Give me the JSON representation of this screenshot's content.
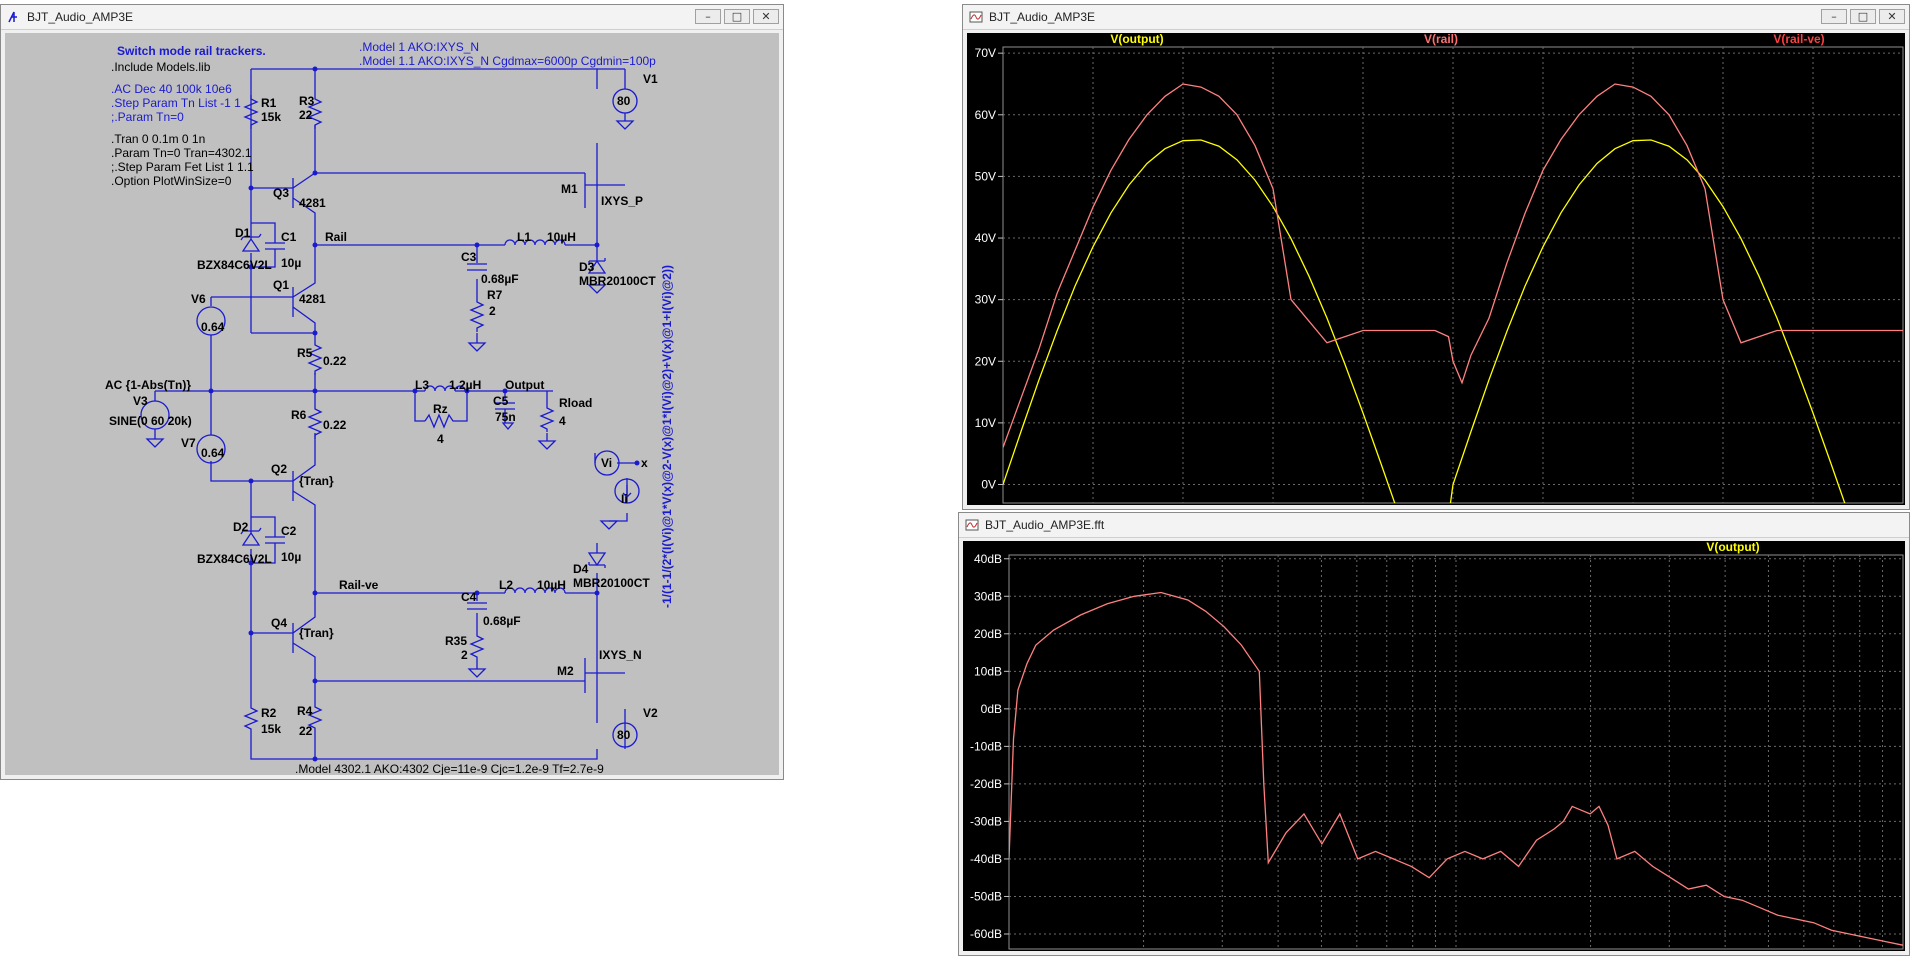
{
  "schematic_window": {
    "title": "BJT_Audio_AMP3E",
    "icon": "schematic-icon"
  },
  "plot_window": {
    "title": "BJT_Audio_AMP3E",
    "icon": "waveform-icon"
  },
  "fft_window": {
    "title": "BJT_Audio_AMP3E.fft",
    "icon": "waveform-icon"
  },
  "window_buttons": {
    "minimize": "–",
    "maximize": "□",
    "close": "✕"
  },
  "colors": {
    "wire": "#1a1ad0",
    "schem_bg": "#c0c0c0",
    "plot_bg": "#000000",
    "trace_output": "#ffff00",
    "trace_rail": "#ff8080",
    "label_output": "#ffff00",
    "label_rail": "#ff7070",
    "label_railve": "#ff4040",
    "grid": "#707070"
  },
  "directives": [
    "Switch mode rail trackers.",
    ".Include Models.lib",
    ".AC Dec 40 100k 10e6",
    ".Step Param Tn List -1 1",
    ";.Param Tn=0",
    ".Tran 0 0.1m 0 1n",
    ".Param Tn=0 Tran=4302.1",
    ";.Step Param Fet List 1 1.1",
    ".Option PlotWinSize=0"
  ],
  "model_directives": [
    ".Model 1 AKO:IXYS_N",
    ".Model 1.1 AKO:IXYS_N Cgdmax=6000p Cgdmin=100p"
  ],
  "bottom_model": ".Model 4302.1 AKO:4302 Cje=11e-9 Cjc=1.2e-9 Tf=2.7e-9",
  "vertical_expr": "-1/(1-1/(2*(I(Vi)@1*V(x)@2-V(x)@1*I(Vi)@2)+V(x)@1+I(Vi)@2))",
  "components": {
    "R1": "R1",
    "R1v": "15k",
    "R3": "R3",
    "R3v": "22",
    "V1": "V1",
    "V1v": "80",
    "Q3": "Q3",
    "Q3v": "4281",
    "M1": "M1",
    "M1v": "IXYS_P",
    "D1": "D1",
    "D1v": "BZX84C6V2L",
    "C1": "C1",
    "C1v": "10µ",
    "Rail": "Rail",
    "C3": "C3",
    "C3v": "0.68µF",
    "L1": "L1",
    "L1v": "10µH",
    "D3": "D3",
    "D3v": "MBR20100CT",
    "R7": "R7",
    "R7v": "2",
    "Q1": "Q1",
    "Q1v": "4281",
    "V6": "V6",
    "V6v": "0.64",
    "R5": "R5",
    "R5v": "0.22",
    "AC": "AC {1-Abs(Tn)}",
    "V3": "V3",
    "V3v": "SINE(0 60 20k)",
    "L3": "L3",
    "L3v": "1.2µH",
    "Output": "Output",
    "Rz": "Rz",
    "Rzv": "4",
    "C5": "C5",
    "C5v": "75n",
    "Rload": "Rload",
    "Rloadv": "4",
    "R6": "R6",
    "R6v": "0.22",
    "V7": "V7",
    "V7v": "0.64",
    "Vi": "Vi",
    "Ii": "Ii",
    "X": "x",
    "Q2": "Q2",
    "Q2v": "{Tran}",
    "D2": "D2",
    "D2v": "BZX84C6V2L",
    "C2": "C2",
    "C2v": "10µ",
    "D4": "D4",
    "D4v": "MBR20100CT",
    "Railve": "Rail-ve",
    "C4": "C4",
    "C4v": "0.68µF",
    "L2": "L2",
    "L2v": "10µH",
    "R35": "R35",
    "R35v": "2",
    "Q4": "Q4",
    "Q4v": "{Tran}",
    "M2": "M2",
    "M2v": "IXYS_N",
    "R2": "R2",
    "R2v": "15k",
    "R4": "R4",
    "R4v": "22",
    "V2": "V2",
    "V2v": "80"
  },
  "chart_data": [
    {
      "type": "line",
      "title": "",
      "legend": [
        "V(output)",
        "V(rail)",
        "V(rail-ve)"
      ],
      "y_tick_labels": [
        "0V",
        "10V",
        "20V",
        "30V",
        "40V",
        "50V",
        "60V",
        "70V"
      ],
      "ylim": [
        -3,
        71
      ],
      "xlim": [
        0,
        100
      ],
      "grid": true,
      "series": [
        {
          "name": "V(output)",
          "color": "#ffff00",
          "x": [
            0,
            2,
            4,
            6,
            8,
            10,
            12,
            14,
            16,
            18,
            20,
            22,
            24,
            26,
            28,
            30,
            32,
            34,
            36,
            38,
            40,
            42,
            44,
            46,
            48,
            50,
            52,
            54,
            56,
            58,
            60,
            62,
            64,
            66,
            68,
            70,
            72,
            74,
            76,
            78,
            80,
            82,
            84,
            86,
            88,
            90,
            92,
            94,
            96,
            98,
            100
          ],
          "y": [
            0,
            8.6,
            17,
            24.9,
            32.2,
            38.6,
            44.1,
            48.6,
            52.1,
            54.5,
            55.8,
            55.9,
            54.9,
            52.7,
            49.4,
            45.1,
            39.9,
            33.8,
            27,
            19.5,
            11.6,
            3.4,
            -5,
            -13.3,
            -21.3,
            0,
            8.6,
            17,
            24.9,
            32.2,
            38.6,
            44.1,
            48.6,
            52.1,
            54.5,
            55.8,
            55.9,
            54.9,
            52.7,
            49.4,
            45.1,
            39.9,
            33.8,
            27,
            19.5,
            11.6,
            3.4,
            -5,
            -13.3,
            -21.3,
            -28.8
          ]
        },
        {
          "name": "V(rail)",
          "color": "#ff8080",
          "x": [
            0,
            2,
            4,
            6,
            8,
            10,
            12,
            14,
            16,
            18,
            20,
            22,
            24,
            26,
            28,
            30,
            32,
            36,
            40,
            44,
            48,
            49.5,
            50,
            51,
            52,
            54,
            56,
            58,
            60,
            62,
            64,
            66,
            68,
            70,
            72,
            74,
            76,
            78,
            80,
            82,
            86,
            90,
            94,
            98,
            100
          ],
          "y": [
            6,
            14,
            22,
            31,
            38,
            45,
            51,
            56,
            60,
            63,
            65,
            64.5,
            63,
            60,
            55,
            48,
            30,
            23,
            25,
            25,
            25,
            24,
            20,
            16.5,
            21,
            27,
            36,
            44,
            51,
            56,
            60,
            63,
            65,
            64.5,
            63,
            60,
            55,
            48,
            30,
            23,
            25,
            25,
            25,
            25,
            25
          ]
        }
      ]
    },
    {
      "type": "line",
      "title": "",
      "legend": [
        "V(output)"
      ],
      "y_tick_labels": [
        "-60dB",
        "-50dB",
        "-40dB",
        "-30dB",
        "-20dB",
        "-10dB",
        "0dB",
        "10dB",
        "20dB",
        "30dB",
        "40dB"
      ],
      "ylim": [
        -64,
        41
      ],
      "xlim": [
        0,
        100
      ],
      "grid": true,
      "series": [
        {
          "name": "V(output)",
          "color": "#ff8080",
          "x": [
            0,
            0.5,
            1,
            2,
            3,
            5,
            8,
            11,
            14,
            17,
            20,
            22,
            24,
            26,
            28,
            28.5,
            29,
            31,
            33,
            35,
            37,
            39,
            41,
            43,
            45,
            47,
            49,
            51,
            53,
            55,
            57,
            59,
            61,
            62,
            63,
            64,
            65,
            66,
            67,
            68,
            70,
            72,
            74,
            76,
            78,
            80,
            82,
            84,
            86,
            88,
            90,
            92,
            94,
            96,
            98,
            100
          ],
          "y": [
            -40,
            -8,
            5,
            12,
            17,
            21,
            25,
            28,
            30,
            31,
            29,
            26,
            22,
            17,
            10,
            -20,
            -41,
            -33,
            -28,
            -36,
            -28,
            -40,
            -38,
            -40,
            -42,
            -45,
            -40,
            -38,
            -40,
            -38,
            -42,
            -35,
            -32,
            -30,
            -26,
            -27,
            -28,
            -26,
            -31,
            -40,
            -38,
            -42,
            -45,
            -48,
            -47,
            -50,
            -51,
            -53,
            -55,
            -56,
            -57,
            -59,
            -60,
            -61,
            -62,
            -63
          ]
        }
      ]
    }
  ]
}
